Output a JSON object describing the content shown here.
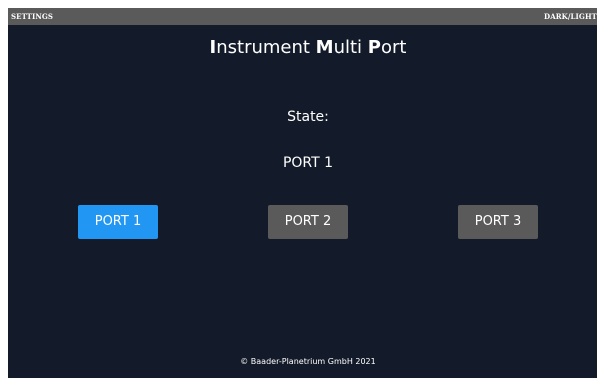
{
  "topbar": {
    "settings_label": "SETTINGS",
    "theme_label": "DARK/LIGHT"
  },
  "header": {
    "title_parts": [
      {
        "cap": "I",
        "rest": "nstrument "
      },
      {
        "cap": "M",
        "rest": "ulti "
      },
      {
        "cap": "P",
        "rest": "ort"
      }
    ]
  },
  "state": {
    "label": "State:",
    "value": "PORT 1"
  },
  "ports": [
    {
      "label": "PORT 1",
      "active": true
    },
    {
      "label": "PORT 2",
      "active": false
    },
    {
      "label": "PORT 3",
      "active": false
    }
  ],
  "footer": {
    "copyright": "© Baader-Planetrium GmbH 2021"
  },
  "colors": {
    "background": "#131b2a",
    "topbar": "#5a5a5a",
    "active_port": "#2196f3",
    "inactive_port": "#5a5a5a"
  }
}
